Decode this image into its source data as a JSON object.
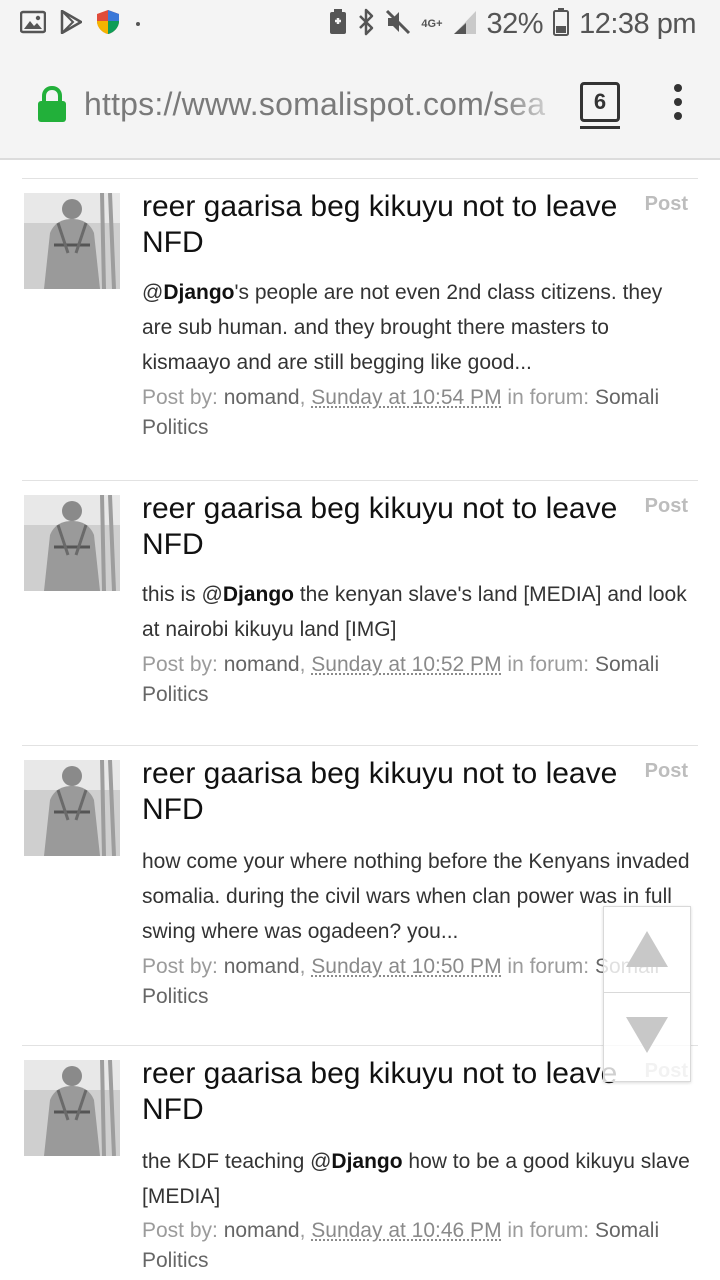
{
  "status_bar": {
    "left_icons": [
      "image-icon",
      "play-store-icon",
      "shield-icon"
    ],
    "right_icons": [
      "battery-saver-icon",
      "bluetooth-icon",
      "mute-icon",
      "signal-icon",
      "battery-icon"
    ],
    "network": "4G+",
    "battery": "32%",
    "time": "12:38 pm"
  },
  "browser": {
    "url": "https://www.somalispot.com/sea",
    "tab_count": "6"
  },
  "results": [
    {
      "title": "reer gaarisa beg kikuyu not to leave NFD",
      "type": "Post",
      "snippet_pre": "@",
      "mention": "Django",
      "snippet_post": "'s people are not even 2nd class citizens. they are sub human. and they brought there masters to kismaayo and are still begging like good...",
      "meta_prefix": "Post by: ",
      "author": "nomand",
      "date": "Sunday at 10:54 PM",
      "meta_mid": " in forum: ",
      "forum": "Somali Politics"
    },
    {
      "title": "reer gaarisa beg kikuyu not to leave NFD",
      "type": "Post",
      "snippet_pre": "this is @",
      "mention": "Django",
      "snippet_post": " the kenyan slave's land [MEDIA] and look at nairobi kikuyu land [IMG]",
      "meta_prefix": "Post by: ",
      "author": "nomand",
      "date": "Sunday at 10:52 PM",
      "meta_mid": " in forum: ",
      "forum": "Somali Politics"
    },
    {
      "title": "reer gaarisa beg kikuyu not to leave NFD",
      "type": "Post",
      "snippet_pre": "",
      "mention": "",
      "snippet_post": "how come your where nothing before the Kenyans invaded somalia. during the civil wars when clan power was in full swing where was ogadeen? you...",
      "meta_prefix": "Post by: ",
      "author": "nomand",
      "date": "Sunday at 10:50 PM",
      "meta_mid": " in forum: ",
      "forum": "Somali Politics"
    },
    {
      "title": "reer gaarisa beg kikuyu not to leave NFD",
      "type": "Post",
      "snippet_pre": "the KDF teaching @",
      "mention": "Django",
      "snippet_post": " how to be a good kikuyu slave [MEDIA]",
      "meta_prefix": "Post by: ",
      "author": "nomand",
      "date": "Sunday at 10:46 PM",
      "meta_mid": " in forum: ",
      "forum": "Somali Politics"
    }
  ],
  "scroll_widget": {
    "up_icon": "triangle-up-icon",
    "down_icon": "triangle-down-icon"
  }
}
